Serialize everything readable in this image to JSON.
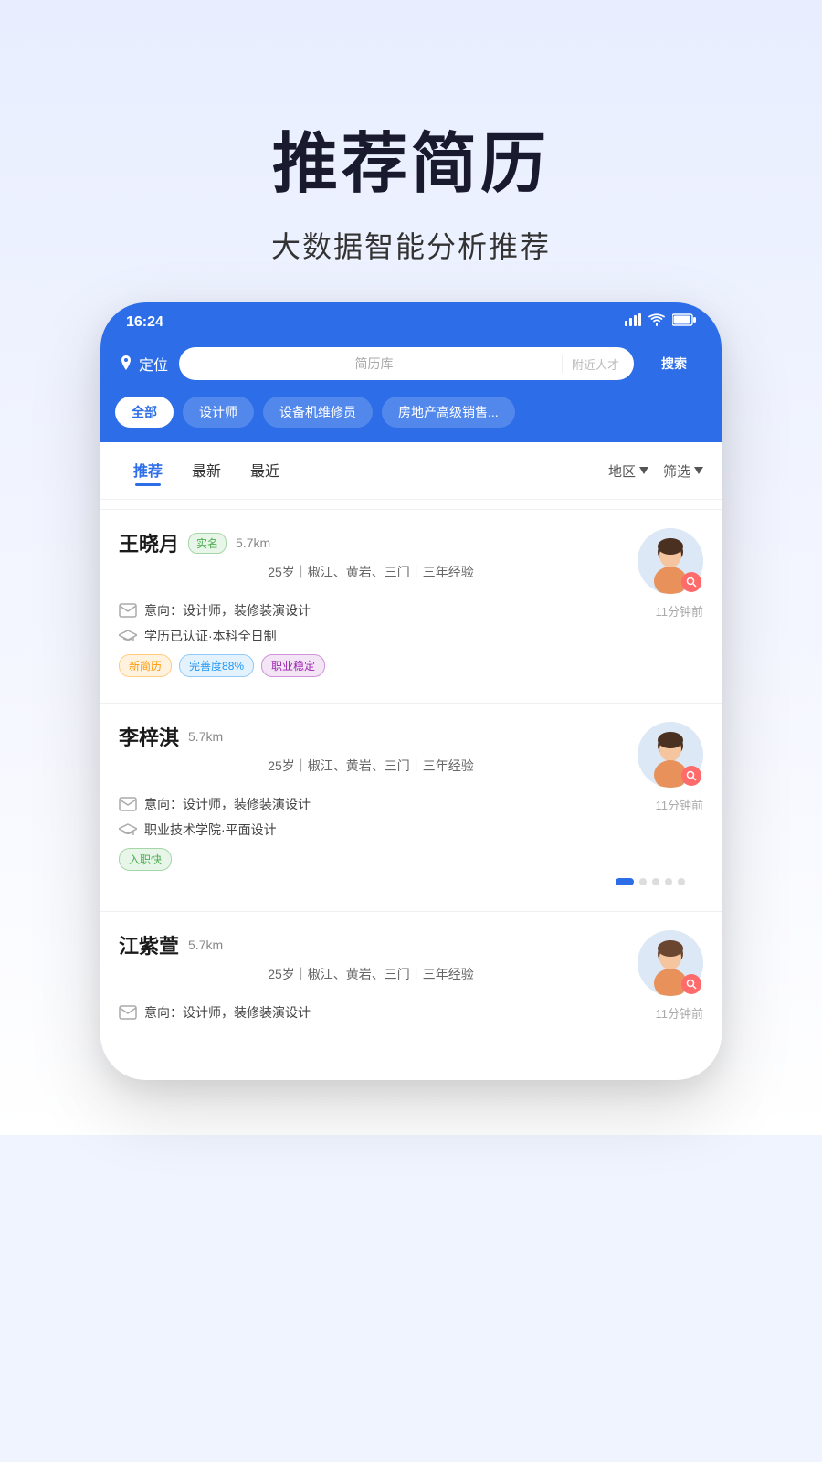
{
  "hero": {
    "title": "推荐简历",
    "subtitle": "大数据智能分析推荐"
  },
  "statusBar": {
    "time": "16:24",
    "signal": "▌▌▌",
    "wifi": "WiFi",
    "battery": "🔋"
  },
  "topBar": {
    "location_label": "定位",
    "search_placeholder": "简历库",
    "search_nearby": "附近人才",
    "search_button": "搜索"
  },
  "categories": [
    {
      "label": "全部",
      "active": true
    },
    {
      "label": "设计师",
      "active": false
    },
    {
      "label": "设备机维修员",
      "active": false
    },
    {
      "label": "房地产高级销售...",
      "active": false
    }
  ],
  "sortTabs": [
    {
      "label": "推荐",
      "active": true
    },
    {
      "label": "最新",
      "active": false
    },
    {
      "label": "最近",
      "active": false
    }
  ],
  "filterButtons": [
    {
      "label": "地区"
    },
    {
      "label": "筛选"
    }
  ],
  "resumes": [
    {
      "name": "王晓月",
      "realNameBadge": "实名",
      "distance": "5.7km",
      "basicInfo": "25岁｜椒江、黄岩、三门｜三年经验",
      "intention": "意向：设计师，装修装演设计",
      "education": "学历已认证·本科全日制",
      "time": "11分钟前",
      "tags": [
        {
          "label": "新简历",
          "type": "new"
        },
        {
          "label": "完善度88%",
          "type": "complete"
        },
        {
          "label": "职业稳定",
          "type": "stable"
        }
      ],
      "hasRealName": true
    },
    {
      "name": "李梓淇",
      "realNameBadge": "",
      "distance": "5.7km",
      "basicInfo": "25岁｜椒江、黄岩、三门｜三年经验",
      "intention": "意向：设计师，装修装演设计",
      "education": "职业技术学院·平面设计",
      "time": "11分钟前",
      "tags": [
        {
          "label": "入职快",
          "type": "fast"
        }
      ],
      "hasRealName": false
    },
    {
      "name": "江紫萱",
      "realNameBadge": "",
      "distance": "5.7km",
      "basicInfo": "25岁｜椒江、黄岩、三门｜三年经验",
      "intention": "意向：设计师，装修装演设计",
      "education": "",
      "time": "11分钟前",
      "tags": [],
      "hasRealName": false
    }
  ]
}
